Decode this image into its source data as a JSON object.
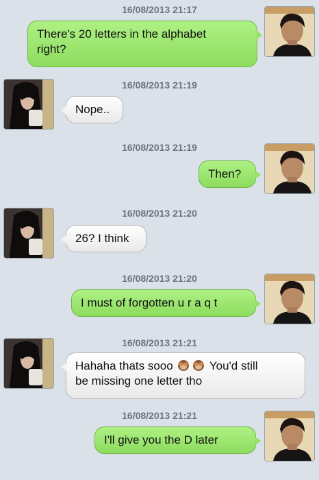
{
  "messages": [
    {
      "timestamp": "16/08/2013 21:17",
      "sender": "him",
      "lines": [
        "There's 20 letters in the alphabet",
        "right?"
      ]
    },
    {
      "timestamp": "16/08/2013 21:19",
      "sender": "her",
      "text": "Nope.."
    },
    {
      "timestamp": "16/08/2013 21:19",
      "sender": "him",
      "text": "Then?"
    },
    {
      "timestamp": "16/08/2013 21:20",
      "sender": "her",
      "text": "26? I think"
    },
    {
      "timestamp": "16/08/2013 21:20",
      "sender": "him",
      "text": "I must of forgotten u r a q t"
    },
    {
      "timestamp": "16/08/2013 21:21",
      "sender": "her",
      "line1_before": "Hahaha thats sooo",
      "line1_after": "You'd still",
      "line2": "be missing one letter tho",
      "emojis": [
        "see-no-evil-monkey-icon",
        "see-no-evil-monkey-icon"
      ]
    },
    {
      "timestamp": "16/08/2013 21:21",
      "sender": "him",
      "text": "I'll give you the D later"
    }
  ],
  "colors": {
    "background": "#dbe1e8",
    "outgoing_bubble": "#9be46f",
    "incoming_bubble": "#f4f4f4",
    "timestamp": "#6c737c"
  }
}
